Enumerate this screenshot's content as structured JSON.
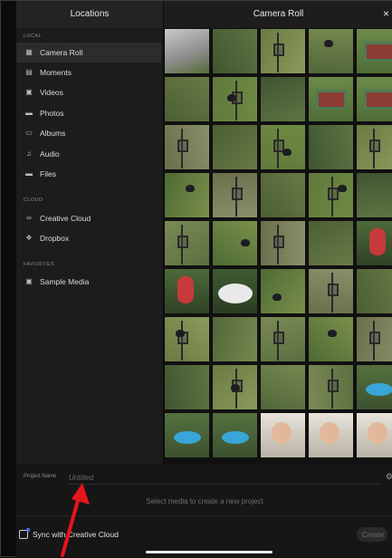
{
  "header": {
    "left_title": "Locations",
    "right_title": "Camera Roll",
    "close_glyph": "×"
  },
  "sidebar": {
    "sections": [
      {
        "label": "LOCAL",
        "items": [
          {
            "label": "Camera Roll",
            "icon": "camera-roll-icon",
            "selected": true
          },
          {
            "label": "Moments",
            "icon": "moments-icon"
          },
          {
            "label": "Videos",
            "icon": "videos-icon"
          },
          {
            "label": "Photos",
            "icon": "photos-icon"
          },
          {
            "label": "Albums",
            "icon": "albums-icon"
          },
          {
            "label": "Audio",
            "icon": "audio-icon"
          },
          {
            "label": "Files",
            "icon": "files-icon"
          }
        ]
      },
      {
        "label": "CLOUD",
        "items": [
          {
            "label": "Creative Cloud",
            "icon": "creative-cloud-icon"
          },
          {
            "label": "Dropbox",
            "icon": "dropbox-icon"
          }
        ]
      },
      {
        "label": "FAVORITES",
        "items": [
          {
            "label": "Sample Media",
            "icon": "sample-media-icon"
          }
        ]
      }
    ]
  },
  "bottom": {
    "project_name_label": "Project Name",
    "project_name_placeholder": "Untitled",
    "hint": "Select media to create a new project",
    "sync_label": "Sync with Creative Cloud",
    "create_label": "Create"
  },
  "colors": {
    "accent": "#3a7cff",
    "annotation_arrow": "#e8141c"
  }
}
